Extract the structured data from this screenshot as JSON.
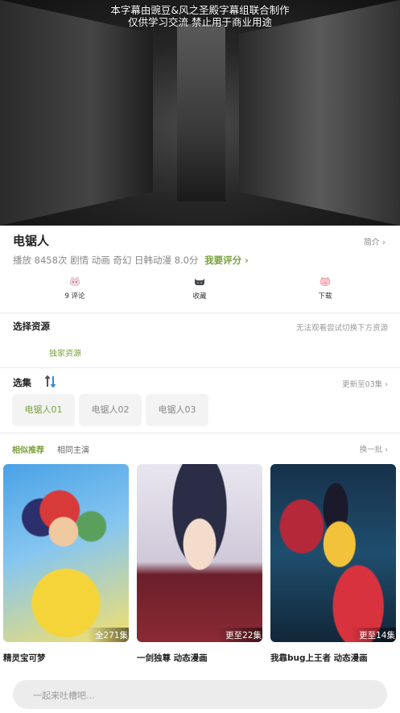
{
  "video": {
    "subtitle_line1": "本字幕由豌豆&风之圣殿字幕组联合制作",
    "subtitle_line2": "仅供学习交流 禁止用于商业用途"
  },
  "detail": {
    "title": "电锯人",
    "intro_label": "简介 ›",
    "meta": "播放 8458次  剧情 动画 奇幻 日韩动漫  8.0分",
    "rate_label": "我要评分 ›"
  },
  "actions": [
    {
      "label": "9 评论",
      "icon": "rabbit-icon"
    },
    {
      "label": "收藏",
      "icon": "cat-icon"
    },
    {
      "label": "下载",
      "icon": "pig-icon"
    }
  ],
  "source": {
    "title": "选择资源",
    "hint": "无法观看尝试切换下方资源",
    "selected": "独家资源"
  },
  "episodes": {
    "title": "选集",
    "sort_icon": "sort-icon",
    "update_label": "更新至03集 ›",
    "items": [
      "电锯人01",
      "电锯人02",
      "电锯人03"
    ],
    "active_index": 0
  },
  "recommend": {
    "tab_similar": "相似推荐",
    "tab_cast": "相同主演",
    "refresh": "换一批 ›",
    "cards": [
      {
        "name": "精灵宝可梦",
        "badge": "全271集"
      },
      {
        "name": "一剑独尊 动态漫画",
        "badge": "更至22集"
      },
      {
        "name": "我靠bug上王者 动态漫画",
        "badge": "更至14集"
      }
    ]
  },
  "comment": {
    "placeholder": "一起来吐槽吧..."
  },
  "colors": {
    "accent": "#7aa13d",
    "blue": "#2f8fd8"
  }
}
